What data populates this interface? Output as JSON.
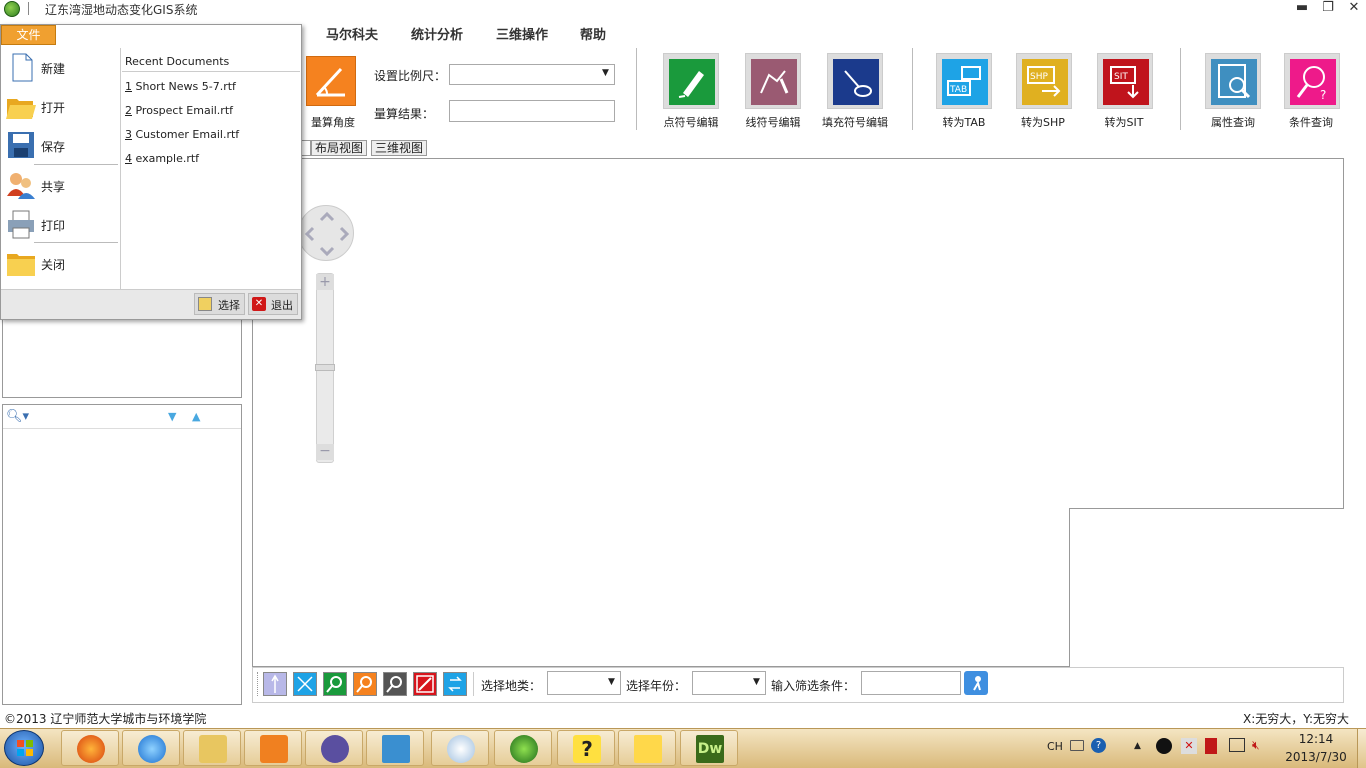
{
  "window": {
    "title": "辽东湾湿地动态变化GIS系统",
    "controls": {
      "minimize": "▬",
      "restore": "❐",
      "close": "✕"
    }
  },
  "ribbon": {
    "tabs": [
      "马尔科夫",
      "统计分析",
      "三维操作",
      "帮助"
    ],
    "measure_angle_label": "量算角度",
    "scale_label": "设置比例尺：",
    "scale_value": "",
    "result_label": "量算结果：",
    "result_value": "",
    "buttons": [
      {
        "label": "点符号编辑",
        "color": "#1a9a3c"
      },
      {
        "label": "线符号编辑",
        "color": "#9a5a72"
      },
      {
        "label": "填充符号编辑",
        "color": "#1b3a8c"
      },
      {
        "label": "转为TAB",
        "color": "#1ea3e6"
      },
      {
        "label": "转为SHP",
        "color": "#e0b020"
      },
      {
        "label": "转为SIT",
        "color": "#c0141c"
      },
      {
        "label": "属性查询",
        "color": "#3f8fc0"
      },
      {
        "label": "条件查询",
        "color": "#ee1a8a"
      }
    ]
  },
  "view_tabs": [
    "布局视图",
    "三维视图"
  ],
  "file_menu": {
    "tab_label": "文件",
    "items": [
      {
        "label": "新建",
        "icon": "new-document-icon"
      },
      {
        "label": "打开",
        "icon": "open-folder-icon"
      },
      {
        "label": "保存",
        "icon": "save-disk-icon"
      },
      {
        "label": "共享",
        "icon": "share-users-icon"
      },
      {
        "label": "打印",
        "icon": "printer-icon"
      },
      {
        "label": "关闭",
        "icon": "close-folder-icon"
      }
    ],
    "recent_header": "Recent Documents",
    "recent": [
      {
        "num": "1",
        "name": " Short News 5-7.rtf"
      },
      {
        "num": "2",
        "name": " Prospect Email.rtf"
      },
      {
        "num": "3",
        "name": " Customer Email.rtf"
      },
      {
        "num": "4",
        "name": " example.rtf"
      }
    ],
    "options_label": "选择",
    "exit_label": "退出"
  },
  "bottom_toolbar": {
    "land_type_label": "选择地类：",
    "land_type_value": "",
    "year_label": "选择年份：",
    "year_value": "",
    "filter_label": "输入筛选条件：",
    "filter_value": ""
  },
  "status": {
    "copyright": "©2013 辽宁师范大学城市与环境学院",
    "coords": "X:无穷大，Y:无穷大"
  },
  "taskbar": {
    "tray_lang": "CH",
    "time": "12:14",
    "date": "2013/7/30",
    "apps": [
      "firefox-icon",
      "ie-icon",
      "explorer-icon",
      "media-icon",
      "infinity-icon",
      "photo-icon",
      "paint-icon",
      "globe-icon",
      "help-icon",
      "sticky-notes-icon",
      "dreamweaver-icon"
    ],
    "dw_label": "Dw"
  }
}
